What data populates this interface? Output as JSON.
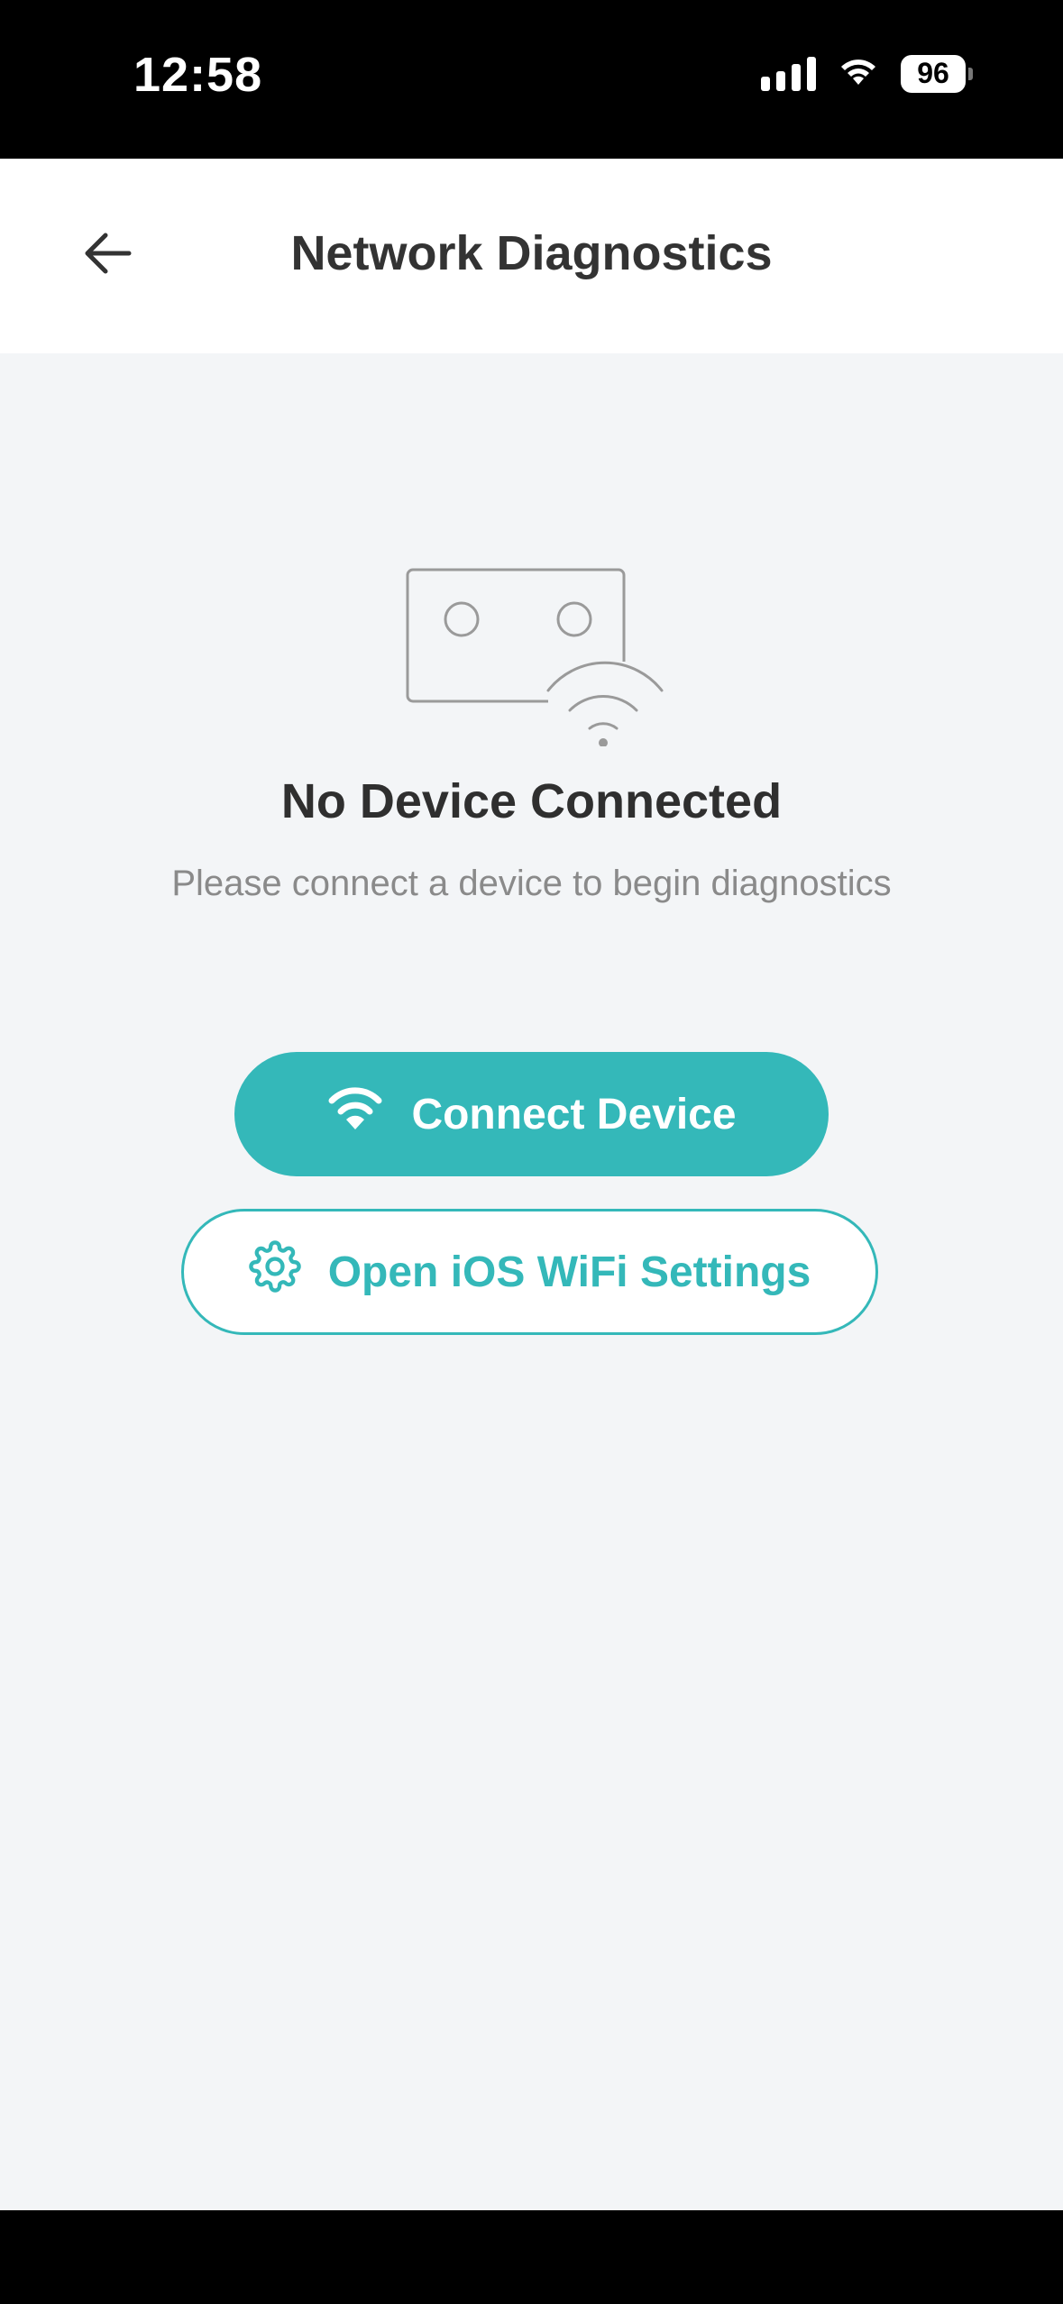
{
  "status_bar": {
    "time": "12:58",
    "battery_level": "96",
    "icons": [
      "cellular-signal-icon",
      "wifi-icon",
      "battery-icon"
    ]
  },
  "header": {
    "back_icon": "arrow-left-icon",
    "title": "Network Diagnostics"
  },
  "empty_state": {
    "illustration": "device-disconnected-illustration",
    "title": "No Device Connected",
    "subtitle": "Please connect a device to begin diagnostics"
  },
  "actions": {
    "connect": {
      "icon": "wifi-icon",
      "label": "Connect Device"
    },
    "open_settings": {
      "icon": "gear-icon",
      "label": "Open iOS WiFi Settings"
    }
  },
  "colors": {
    "accent": "#34b8b9",
    "background": "#f3f5f7",
    "title_text": "#333333",
    "subtitle_text": "#8a8a8a"
  }
}
